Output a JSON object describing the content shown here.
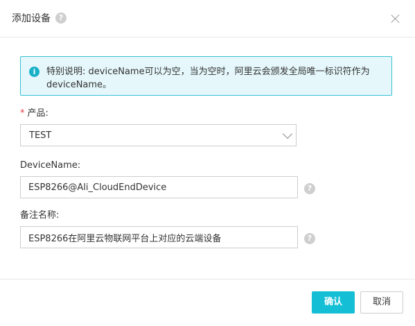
{
  "dialog": {
    "title": "添加设备",
    "help_glyph": "?",
    "close_glyph": ""
  },
  "notice": {
    "info_glyph": "i",
    "text": "特别说明: deviceName可以为空，当为空时，阿里云会颁发全局唯一标识符作为deviceName。"
  },
  "form": {
    "product": {
      "required_mark": "*",
      "label": "产品:",
      "value": "TEST"
    },
    "device_name": {
      "label": "DeviceName:",
      "value": "ESP8266@Ali_CloudEndDevice",
      "help_glyph": "?"
    },
    "note_name": {
      "label": "备注名称:",
      "value": "ESP8266在阿里云物联网平台上对应的云端设备",
      "help_glyph": "?"
    }
  },
  "footer": {
    "confirm_label": "确认",
    "cancel_label": "取消"
  }
}
